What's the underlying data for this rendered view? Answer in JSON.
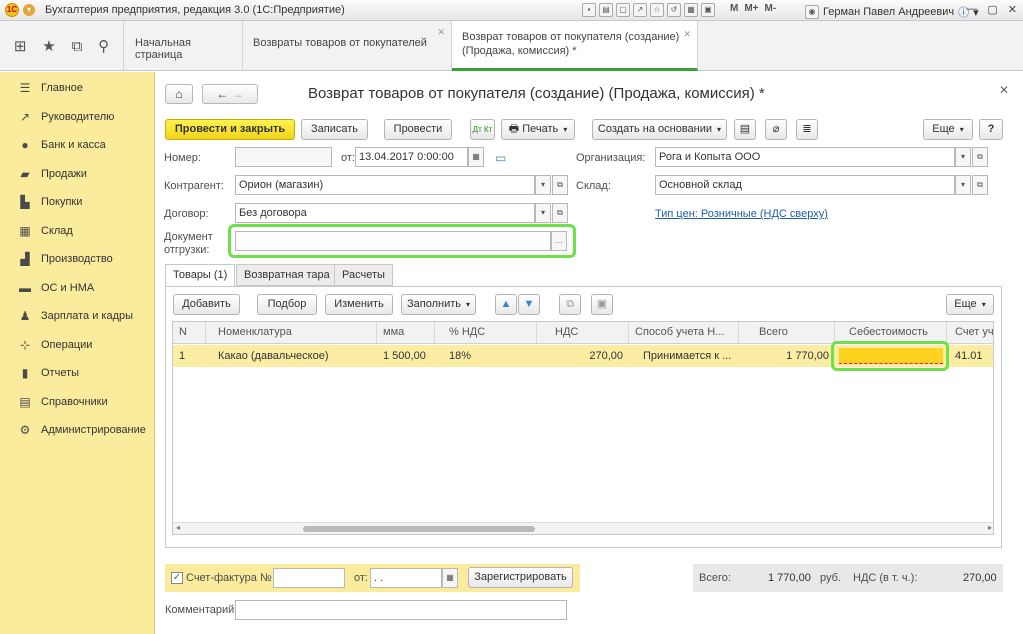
{
  "window": {
    "title": "Бухгалтерия предприятия, редакция 3.0  (1С:Предприятие)",
    "user": "Герман Павел Андреевич",
    "mm_buttons": [
      "M",
      "M+",
      "M-"
    ]
  },
  "tabs": [
    {
      "label": "Начальная страница"
    },
    {
      "label": "Возвраты товаров от покупателей"
    },
    {
      "label_line1": "Возврат товаров от покупателя (создание)",
      "label_line2": "(Продажа, комиссия) *"
    }
  ],
  "sidebar": {
    "items": [
      {
        "label": "Главное",
        "icon": "menu-icon"
      },
      {
        "label": "Руководителю",
        "icon": "chart-line-icon"
      },
      {
        "label": "Банк и касса",
        "icon": "coin-icon"
      },
      {
        "label": "Продажи",
        "icon": "bag-icon"
      },
      {
        "label": "Покупки",
        "icon": "cart-icon"
      },
      {
        "label": "Склад",
        "icon": "grid-icon"
      },
      {
        "label": "Производство",
        "icon": "factory-icon"
      },
      {
        "label": "ОС и НМА",
        "icon": "car-icon"
      },
      {
        "label": "Зарплата и кадры",
        "icon": "person-icon"
      },
      {
        "label": "Операции",
        "icon": "operations-icon"
      },
      {
        "label": "Отчеты",
        "icon": "bars-icon"
      },
      {
        "label": "Справочники",
        "icon": "book-icon"
      },
      {
        "label": "Администрирование",
        "icon": "gear-icon"
      }
    ]
  },
  "form": {
    "title": "Возврат товаров от покупателя (создание) (Продажа, комиссия) *",
    "toolbar": {
      "post_close": "Провести и закрыть",
      "save": "Записать",
      "post": "Провести",
      "print": "Печать",
      "create_based": "Создать на основании",
      "more": "Еще",
      "help": "?"
    },
    "number_label": "Номер:",
    "number_value": "",
    "date_label": "от:",
    "date_value": "13.04.2017  0:00:00",
    "org_label": "Организация:",
    "org_value": "Рога и Копыта ООО",
    "contractor_label": "Контрагент:",
    "contractor_value": "Орион (магазин)",
    "warehouse_label": "Склад:",
    "warehouse_value": "Основной склад",
    "contract_label": "Договор:",
    "contract_value": "Без договора",
    "price_type_link": "Тип цен: Розничные (НДС сверху)",
    "shipment_label_1": "Документ",
    "shipment_label_2": "отгрузки:",
    "shipment_value": ""
  },
  "form_tabs": [
    {
      "label": "Товары (1)"
    },
    {
      "label": "Возвратная тара"
    },
    {
      "label": "Расчеты"
    }
  ],
  "table_toolbar": {
    "add": "Добавить",
    "select": "Подбор",
    "change": "Изменить",
    "fill": "Заполнить",
    "more": "Еще"
  },
  "table": {
    "columns": [
      "N",
      "Номенклатура",
      "мма",
      "% НДС",
      "НДС",
      "Способ учета Н...",
      "Всего",
      "Себестоимость",
      "Счет уч"
    ],
    "rows": [
      [
        "1",
        "Какао (давальческое)",
        "1 500,00",
        "18%",
        "270,00",
        "Принимается к ...",
        "1 770,00",
        "",
        "41.01"
      ]
    ]
  },
  "invoice": {
    "label": "Счет-фактура №",
    "number": "",
    "date_label": "от:",
    "date_value": " .  .",
    "register": "Зарегистрировать"
  },
  "totals": {
    "total_label": "Всего:",
    "total_value": "1 770,00",
    "currency": "руб.",
    "vat_label": "НДС (в т. ч.):",
    "vat_value": "270,00"
  },
  "comment_label": "Комментарий:",
  "comment_value": ""
}
